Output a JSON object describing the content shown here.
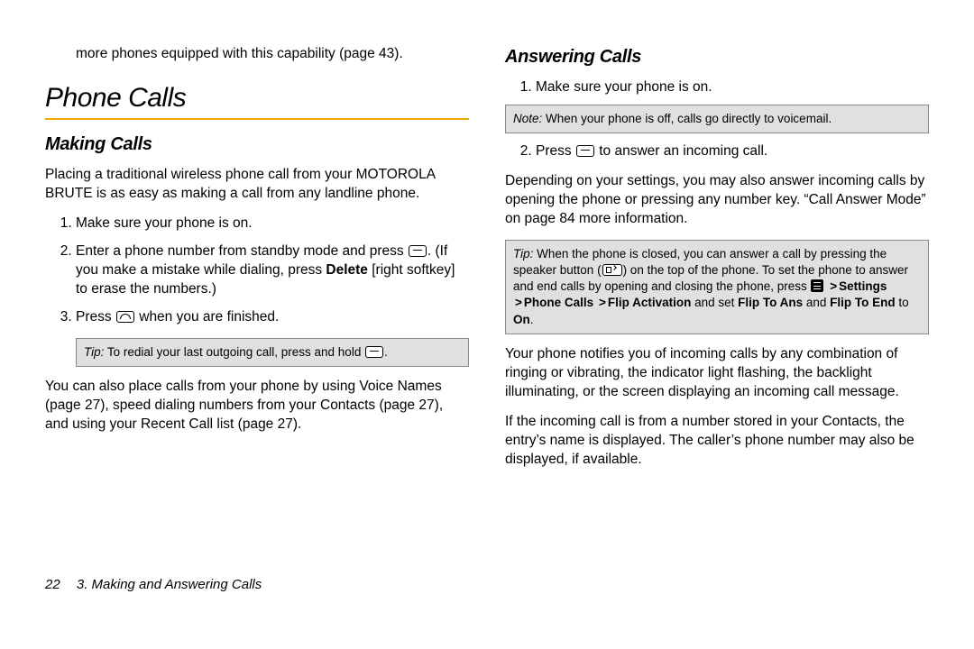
{
  "left": {
    "continued": "more phones equipped with this capability (page 43).",
    "h1": "Phone Calls",
    "h2": "Making Calls",
    "intro": "Placing a traditional wireless phone call from your MOTOROLA BRUTE is as easy as making a call from any landline phone.",
    "steps": {
      "s1": "Make sure your phone is on.",
      "s2a": "Enter a phone number from standby mode and press ",
      "s2b": ". (If you make a mistake while dialing, press ",
      "s2c": " [right softkey] to erase the numbers.)",
      "deleteLabel": "Delete",
      "s3a": "Press ",
      "s3b": " when you are finished."
    },
    "tipLead": "Tip:",
    "tipText": "To redial your last outgoing call, press and hold ",
    "afterTip": "You can also place calls from your phone by using Voice Names (page 27), speed dialing numbers from your Contacts (page 27), and using your Recent Call list (page 27)."
  },
  "right": {
    "h2": "Answering Calls",
    "s1": "Make sure your phone is on.",
    "noteLead": "Note:",
    "noteText": "When your phone is off, calls go directly to voicemail.",
    "s2a": "Press ",
    "s2b": " to answer an incoming call.",
    "para1": "Depending on your settings, you may also answer incoming calls by opening the phone or pressing any number key. “Call Answer Mode” on page 84 more information.",
    "tip": {
      "lead": "Tip:",
      "a": "When the phone is closed, you can answer a call by pressing the speaker button (",
      "b": ") on the top of the phone. To set the phone to answer and end calls by opening and closing the phone, press ",
      "settings": "Settings",
      "phoneCalls": "Phone Calls",
      "flipAct": "Flip Activation",
      "andSet": " and set ",
      "flipAns": "Flip To Ans",
      "and": " and ",
      "flipEnd": "Flip To End",
      "to": " to ",
      "on": "On",
      "dot": "."
    },
    "para2": "Your phone notifies you of incoming calls by any combination of ringing or vibrating, the indicator light flashing, the backlight illuminating, or the screen displaying an incoming call message.",
    "para3": "If the incoming call is from a number stored in your Contacts, the entry’s name is displayed. The caller’s phone number may also be displayed, if available."
  },
  "footer": {
    "page": "22",
    "chapter": "3. Making and Answering Calls"
  }
}
